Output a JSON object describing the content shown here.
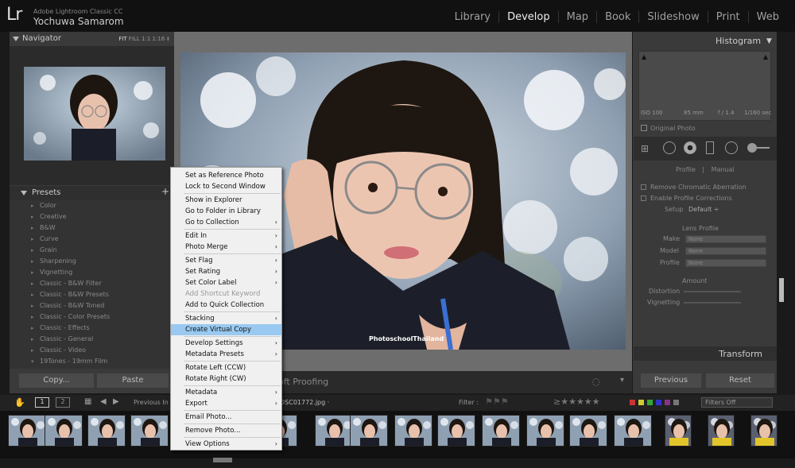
{
  "app": {
    "logo": "Lr",
    "name": "Adobe Lightroom Classic CC",
    "user": "Yochuwa Samarom"
  },
  "modules": [
    "Library",
    "Develop",
    "Map",
    "Book",
    "Slideshow",
    "Print",
    "Web"
  ],
  "active_module": "Develop",
  "navigator": {
    "title": "Navigator",
    "zoom_options": [
      "FIT",
      "FILL",
      "1:1",
      "1:16 ‡"
    ]
  },
  "presets": {
    "title": "Presets",
    "add": "+",
    "items": [
      "Color",
      "Creative",
      "B&W",
      "Curve",
      "Grain",
      "Sharpening",
      "Vignetting",
      "Classic - B&W Filter",
      "Classic - B&W Presets",
      "Classic - B&W Toned",
      "Classic - Color Presets",
      "Classic - Effects",
      "Classic - General",
      "Classic - Video",
      "19Tones - 19mm Film"
    ]
  },
  "left_buttons": {
    "copy": "Copy...",
    "paste": "Paste"
  },
  "soft_proofing": "oft Proofing",
  "watermark": "PhotoschoolThailand",
  "histogram": {
    "title": "Histogram",
    "iso": "ISO 100",
    "focal": "85 mm",
    "aperture": "f / 1.4",
    "shutter": "1/160 sec",
    "original_photo": "Original Photo"
  },
  "lens": {
    "tab_profile": "Profile",
    "tab_sep": "|",
    "tab_manual": "Manual",
    "remove_ca": "Remove Chromatic Aberration",
    "enable_profile": "Enable Profile Corrections",
    "setup_label": "Setup",
    "setup_value": "Default ÷",
    "lens_profile": "Lens Profile",
    "make": "Make",
    "model": "Model",
    "profile": "Profile",
    "none": "None",
    "amount": "Amount",
    "distortion": "Distortion",
    "vignetting": "Vignetting"
  },
  "transform": {
    "title": "Transform"
  },
  "right_buttons": {
    "previous": "Previous",
    "reset": "Reset"
  },
  "filmbar": {
    "page1": "1",
    "page2": "2",
    "prev_import": "Previous In",
    "filename": "DSC01772.jpg ·",
    "filter_label": "Filter :",
    "filters": "Filters Off"
  },
  "context_menu": [
    {
      "label": "Set as Reference Photo",
      "sub": false
    },
    {
      "label": "Lock to Second Window",
      "sub": false
    },
    {
      "sep": true
    },
    {
      "label": "Show in Explorer",
      "sub": false
    },
    {
      "label": "Go to Folder in Library",
      "sub": false
    },
    {
      "label": "Go to Collection",
      "sub": true
    },
    {
      "sep": true
    },
    {
      "label": "Edit In",
      "sub": true
    },
    {
      "label": "Photo Merge",
      "sub": true
    },
    {
      "sep": true
    },
    {
      "label": "Set Flag",
      "sub": true
    },
    {
      "label": "Set Rating",
      "sub": true
    },
    {
      "label": "Set Color Label",
      "sub": true
    },
    {
      "label": "Add Shortcut Keyword",
      "sub": false,
      "disabled": true
    },
    {
      "label": "Add to Quick Collection",
      "sub": false
    },
    {
      "sep": true
    },
    {
      "label": "Stacking",
      "sub": true
    },
    {
      "label": "Create Virtual Copy",
      "sub": false,
      "highlighted": true
    },
    {
      "sep": true
    },
    {
      "label": "Develop Settings",
      "sub": true
    },
    {
      "label": "Metadata Presets",
      "sub": true
    },
    {
      "sep": true
    },
    {
      "label": "Rotate Left (CCW)",
      "sub": false
    },
    {
      "label": "Rotate Right (CW)",
      "sub": false
    },
    {
      "sep": true
    },
    {
      "label": "Metadata",
      "sub": true
    },
    {
      "label": "Export",
      "sub": true
    },
    {
      "sep": true
    },
    {
      "label": "Email Photo...",
      "sub": false
    },
    {
      "sep": true
    },
    {
      "label": "Remove Photo...",
      "sub": false
    },
    {
      "sep": true
    },
    {
      "label": "View Options",
      "sub": true
    }
  ],
  "colors": {
    "menu_highlight": "#99c9f0",
    "panel_bg": "#3a3a3a",
    "stage_bg": "#6d6d6d"
  }
}
